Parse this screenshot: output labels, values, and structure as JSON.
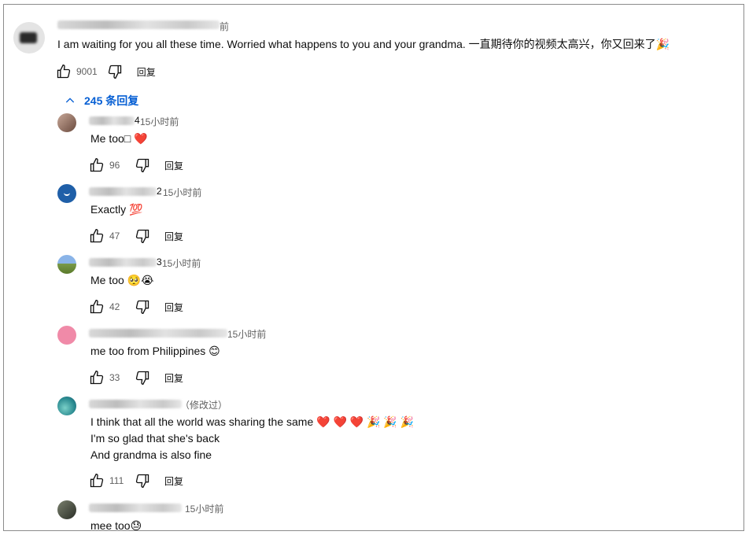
{
  "top_comment": {
    "time": "前",
    "text": "I am waiting for you all these time. Worried what happens to you and your grandma. 一直期待你的视频太高兴，你又回来了🎉",
    "likes": "9001",
    "reply_label": "回复"
  },
  "replies_toggle": {
    "label": "245 条回复"
  },
  "replies": [
    {
      "author_tail": "4",
      "time": "15小时前",
      "text": "Me too□ ❤️",
      "likes": "96",
      "reply_label": "回复",
      "avatar_color": "#8a6a5a"
    },
    {
      "author_tail": "2",
      "time": "15小时前",
      "text": "Exactly 💯",
      "likes": "47",
      "reply_label": "回复",
      "avatar_color": "#1f5fa8"
    },
    {
      "author_tail": "3",
      "time": "15小时前",
      "text": "Me too 🥺😭",
      "likes": "42",
      "reply_label": "回复",
      "avatar_color": "#7a9a4a"
    },
    {
      "author_tail": "",
      "time": "15小时前",
      "text": "me too from Philippines 😊",
      "likes": "33",
      "reply_label": "回复",
      "avatar_color": "#f08aa8"
    },
    {
      "author_tail": "",
      "time": "（修改过）",
      "lines": [
        "I think that all the world was sharing the same ❤️ ❤️ ❤️ 🎉 🎉 🎉",
        "I'm so glad that she's back",
        "And grandma is also fine"
      ],
      "likes": "111",
      "reply_label": "回复",
      "avatar_color": "#3aa6a0"
    },
    {
      "author_tail": "",
      "time": "15小时前",
      "text": "mee too😓",
      "avatar_color": "#4a4f44"
    }
  ],
  "colors": {
    "link": "#065fd4",
    "secondary": "#606060",
    "border": "#8c8c8c"
  }
}
